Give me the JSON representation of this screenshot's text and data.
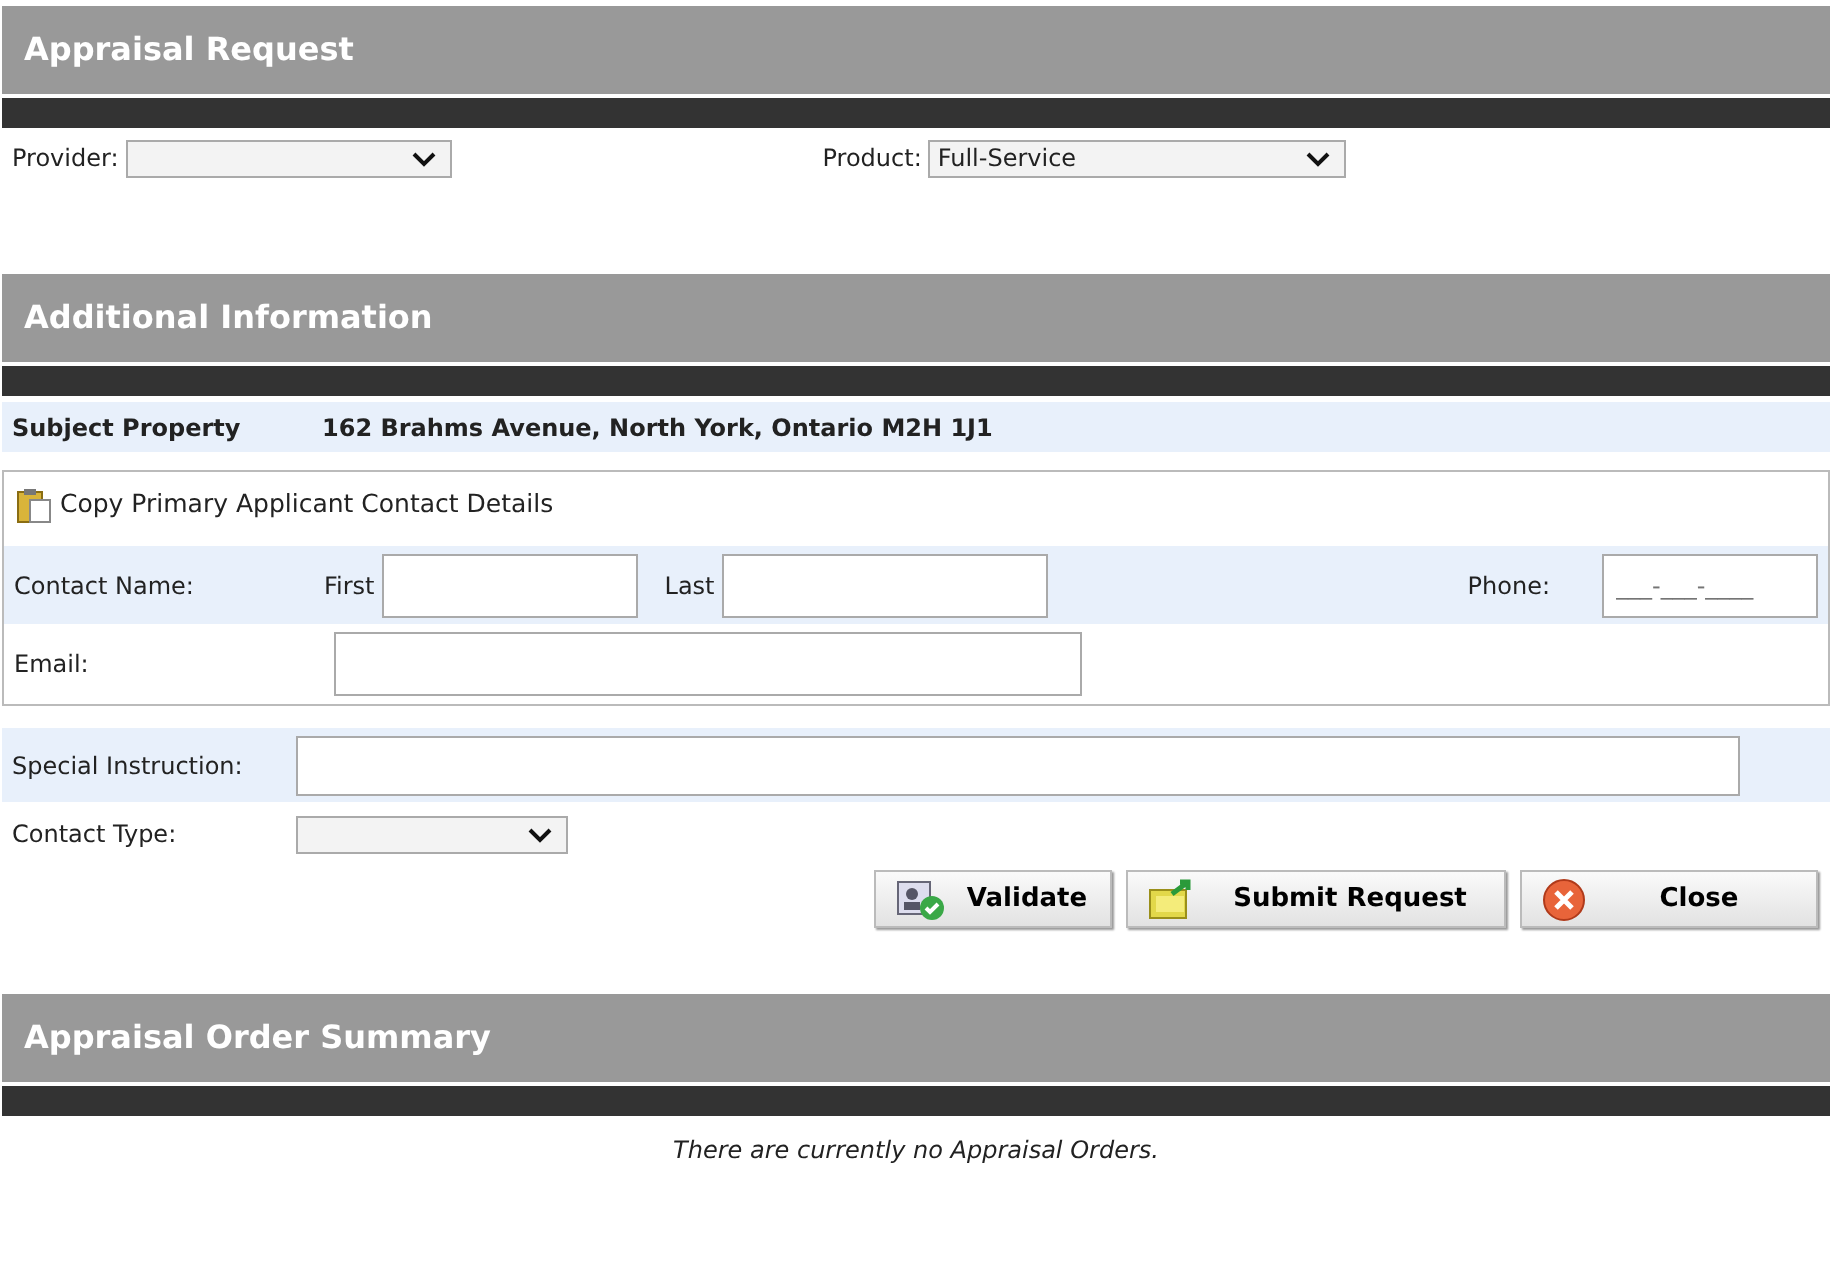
{
  "appraisal_request": {
    "title": "Appraisal Request",
    "provider": {
      "label": "Provider:"
    },
    "product": {
      "label": "Product:",
      "value": "Full-Service"
    }
  },
  "additional_information": {
    "title": "Additional Information",
    "subject_property": {
      "label": "Subject Property",
      "value": "162 Brahms Avenue, North York, Ontario M2H 1J1"
    },
    "copy_link": "Copy Primary Applicant Contact Details",
    "contact_name": {
      "label": "Contact Name:",
      "first_label": "First",
      "last_label": "Last"
    },
    "phone": {
      "label": "Phone:",
      "placeholder": "___-___-____"
    },
    "email": {
      "label": "Email:"
    },
    "special_instruction": {
      "label": "Special Instruction:"
    },
    "contact_type": {
      "label": "Contact Type:"
    },
    "buttons": [
      {
        "kind": "validate",
        "label": "Validate"
      },
      {
        "kind": "submit",
        "label": "Submit Request"
      },
      {
        "kind": "close",
        "label": "Close"
      }
    ]
  },
  "appraisal_order_summary": {
    "title": "Appraisal Order Summary",
    "empty_message": "There are currently no Appraisal Orders."
  }
}
